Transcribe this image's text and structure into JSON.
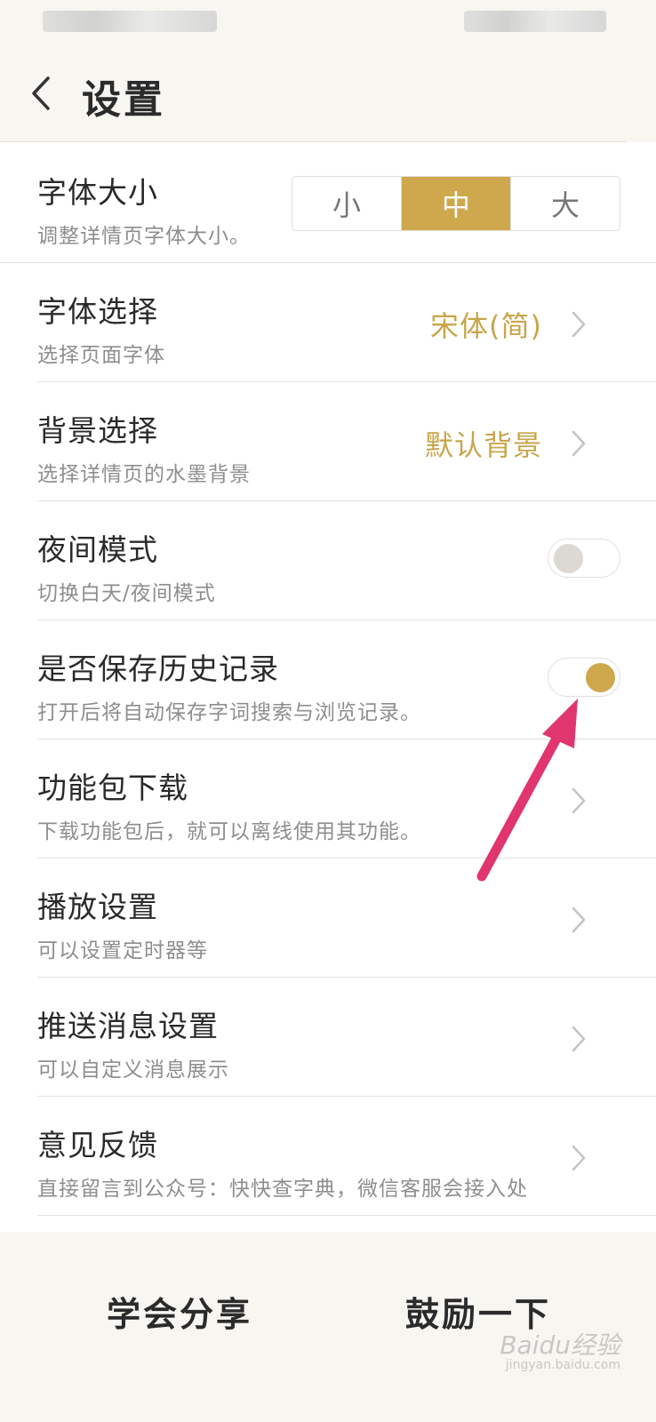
{
  "header": {
    "title": "设置"
  },
  "settings": {
    "font_size": {
      "title": "字体大小",
      "subtitle": "调整详情页字体大小。",
      "options": [
        "小",
        "中",
        "大"
      ],
      "selected": "中"
    },
    "font_select": {
      "title": "字体选择",
      "subtitle": "选择页面字体",
      "value": "宋体(简)"
    },
    "background": {
      "title": "背景选择",
      "subtitle": "选择详情页的水墨背景",
      "value": "默认背景"
    },
    "night_mode": {
      "title": "夜间模式",
      "subtitle": "切换白天/夜间模式",
      "enabled": false
    },
    "save_history": {
      "title": "是否保存历史记录",
      "subtitle": "打开后将自动保存字词搜索与浏览记录。",
      "enabled": true
    },
    "download": {
      "title": "功能包下载",
      "subtitle": "下载功能包后，就可以离线使用其功能。"
    },
    "playback": {
      "title": "播放设置",
      "subtitle": "可以设置定时器等"
    },
    "push": {
      "title": "推送消息设置",
      "subtitle": "可以自定义消息展示"
    },
    "feedback": {
      "title": "意见反馈",
      "subtitle": "直接留言到公众号：快快查字典，微信客服会接入处"
    }
  },
  "bottom": {
    "share_label": "学会分享",
    "encourage_label": "鼓励一下"
  },
  "watermark": {
    "text": "Baidu经验",
    "sub": "jingyan.baidu.com"
  },
  "colors": {
    "accent": "#cfa84d",
    "accent_text": "#c9a54a",
    "annotation_arrow": "#e0356f"
  },
  "icons": {
    "back": "chevron-left-icon",
    "row_arrow": "chevron-right-icon"
  }
}
